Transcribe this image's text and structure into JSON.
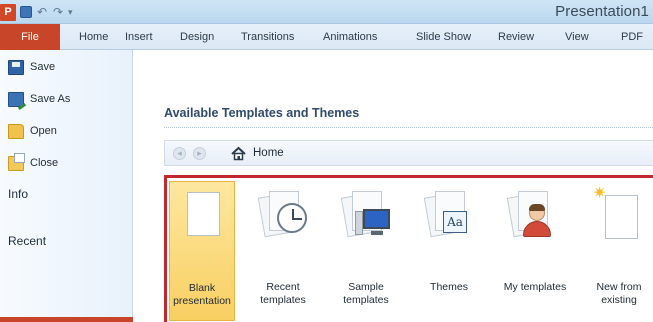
{
  "window": {
    "title": "Presentation1"
  },
  "quick_access": {
    "logo": "P",
    "undo_glyph": "↶",
    "redo_glyph": "↷",
    "more_glyph": "▾"
  },
  "ribbon": {
    "tabs": [
      "File",
      "Home",
      "Insert",
      "Design",
      "Transitions",
      "Animations",
      "Slide Show",
      "Review",
      "View",
      "PDF"
    ]
  },
  "backstage_nav": {
    "items": [
      {
        "label": "Save",
        "icon": "save-icon"
      },
      {
        "label": "Save As",
        "icon": "save-as-icon"
      },
      {
        "label": "Open",
        "icon": "open-folder-icon"
      },
      {
        "label": "Close",
        "icon": "close-folder-icon"
      }
    ],
    "info_label": "Info",
    "recent_label": "Recent"
  },
  "content": {
    "section_title": "Available Templates and Themes",
    "breadcrumb": {
      "back_glyph": "◂",
      "forward_glyph": "▸",
      "home_label": "Home"
    },
    "templates": [
      {
        "label": "Blank\npresentation",
        "icon": "blank-document-icon",
        "selected": true
      },
      {
        "label": "Recent\ntemplates",
        "icon": "recent-templates-icon",
        "selected": false
      },
      {
        "label": "Sample\ntemplates",
        "icon": "sample-templates-icon",
        "selected": false
      },
      {
        "label": "Themes",
        "icon": "themes-icon",
        "selected": false
      },
      {
        "label": "My templates",
        "icon": "my-templates-icon",
        "selected": false
      },
      {
        "label": "New from\nexisting",
        "icon": "new-from-existing-icon",
        "selected": false
      }
    ],
    "themes_glyph": "Aa",
    "sparkle_glyph": "✷"
  },
  "colors": {
    "file_tab": "#c9452a",
    "selection_frame": "#c1272d",
    "selected_tile": "#f9cf61",
    "title_bar": "#b9d7ee"
  }
}
